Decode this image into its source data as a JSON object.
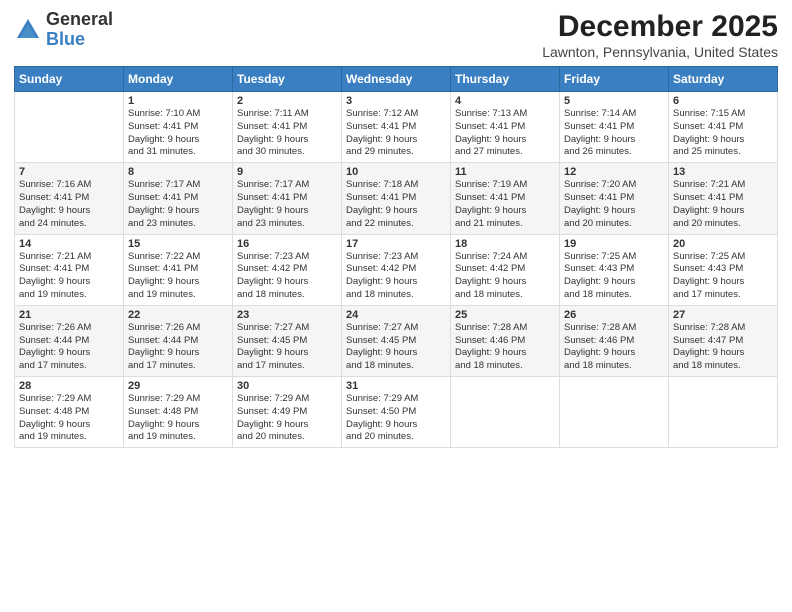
{
  "header": {
    "logo_general": "General",
    "logo_blue": "Blue",
    "month_title": "December 2025",
    "location": "Lawnton, Pennsylvania, United States"
  },
  "days_of_week": [
    "Sunday",
    "Monday",
    "Tuesday",
    "Wednesday",
    "Thursday",
    "Friday",
    "Saturday"
  ],
  "weeks": [
    [
      {
        "day": "",
        "info": ""
      },
      {
        "day": "1",
        "info": "Sunrise: 7:10 AM\nSunset: 4:41 PM\nDaylight: 9 hours\nand 31 minutes."
      },
      {
        "day": "2",
        "info": "Sunrise: 7:11 AM\nSunset: 4:41 PM\nDaylight: 9 hours\nand 30 minutes."
      },
      {
        "day": "3",
        "info": "Sunrise: 7:12 AM\nSunset: 4:41 PM\nDaylight: 9 hours\nand 29 minutes."
      },
      {
        "day": "4",
        "info": "Sunrise: 7:13 AM\nSunset: 4:41 PM\nDaylight: 9 hours\nand 27 minutes."
      },
      {
        "day": "5",
        "info": "Sunrise: 7:14 AM\nSunset: 4:41 PM\nDaylight: 9 hours\nand 26 minutes."
      },
      {
        "day": "6",
        "info": "Sunrise: 7:15 AM\nSunset: 4:41 PM\nDaylight: 9 hours\nand 25 minutes."
      }
    ],
    [
      {
        "day": "7",
        "info": "Sunrise: 7:16 AM\nSunset: 4:41 PM\nDaylight: 9 hours\nand 24 minutes."
      },
      {
        "day": "8",
        "info": "Sunrise: 7:17 AM\nSunset: 4:41 PM\nDaylight: 9 hours\nand 23 minutes."
      },
      {
        "day": "9",
        "info": "Sunrise: 7:17 AM\nSunset: 4:41 PM\nDaylight: 9 hours\nand 23 minutes."
      },
      {
        "day": "10",
        "info": "Sunrise: 7:18 AM\nSunset: 4:41 PM\nDaylight: 9 hours\nand 22 minutes."
      },
      {
        "day": "11",
        "info": "Sunrise: 7:19 AM\nSunset: 4:41 PM\nDaylight: 9 hours\nand 21 minutes."
      },
      {
        "day": "12",
        "info": "Sunrise: 7:20 AM\nSunset: 4:41 PM\nDaylight: 9 hours\nand 20 minutes."
      },
      {
        "day": "13",
        "info": "Sunrise: 7:21 AM\nSunset: 4:41 PM\nDaylight: 9 hours\nand 20 minutes."
      }
    ],
    [
      {
        "day": "14",
        "info": "Sunrise: 7:21 AM\nSunset: 4:41 PM\nDaylight: 9 hours\nand 19 minutes."
      },
      {
        "day": "15",
        "info": "Sunrise: 7:22 AM\nSunset: 4:41 PM\nDaylight: 9 hours\nand 19 minutes."
      },
      {
        "day": "16",
        "info": "Sunrise: 7:23 AM\nSunset: 4:42 PM\nDaylight: 9 hours\nand 18 minutes."
      },
      {
        "day": "17",
        "info": "Sunrise: 7:23 AM\nSunset: 4:42 PM\nDaylight: 9 hours\nand 18 minutes."
      },
      {
        "day": "18",
        "info": "Sunrise: 7:24 AM\nSunset: 4:42 PM\nDaylight: 9 hours\nand 18 minutes."
      },
      {
        "day": "19",
        "info": "Sunrise: 7:25 AM\nSunset: 4:43 PM\nDaylight: 9 hours\nand 18 minutes."
      },
      {
        "day": "20",
        "info": "Sunrise: 7:25 AM\nSunset: 4:43 PM\nDaylight: 9 hours\nand 17 minutes."
      }
    ],
    [
      {
        "day": "21",
        "info": "Sunrise: 7:26 AM\nSunset: 4:44 PM\nDaylight: 9 hours\nand 17 minutes."
      },
      {
        "day": "22",
        "info": "Sunrise: 7:26 AM\nSunset: 4:44 PM\nDaylight: 9 hours\nand 17 minutes."
      },
      {
        "day": "23",
        "info": "Sunrise: 7:27 AM\nSunset: 4:45 PM\nDaylight: 9 hours\nand 17 minutes."
      },
      {
        "day": "24",
        "info": "Sunrise: 7:27 AM\nSunset: 4:45 PM\nDaylight: 9 hours\nand 18 minutes."
      },
      {
        "day": "25",
        "info": "Sunrise: 7:28 AM\nSunset: 4:46 PM\nDaylight: 9 hours\nand 18 minutes."
      },
      {
        "day": "26",
        "info": "Sunrise: 7:28 AM\nSunset: 4:46 PM\nDaylight: 9 hours\nand 18 minutes."
      },
      {
        "day": "27",
        "info": "Sunrise: 7:28 AM\nSunset: 4:47 PM\nDaylight: 9 hours\nand 18 minutes."
      }
    ],
    [
      {
        "day": "28",
        "info": "Sunrise: 7:29 AM\nSunset: 4:48 PM\nDaylight: 9 hours\nand 19 minutes."
      },
      {
        "day": "29",
        "info": "Sunrise: 7:29 AM\nSunset: 4:48 PM\nDaylight: 9 hours\nand 19 minutes."
      },
      {
        "day": "30",
        "info": "Sunrise: 7:29 AM\nSunset: 4:49 PM\nDaylight: 9 hours\nand 20 minutes."
      },
      {
        "day": "31",
        "info": "Sunrise: 7:29 AM\nSunset: 4:50 PM\nDaylight: 9 hours\nand 20 minutes."
      },
      {
        "day": "",
        "info": ""
      },
      {
        "day": "",
        "info": ""
      },
      {
        "day": "",
        "info": ""
      }
    ]
  ]
}
